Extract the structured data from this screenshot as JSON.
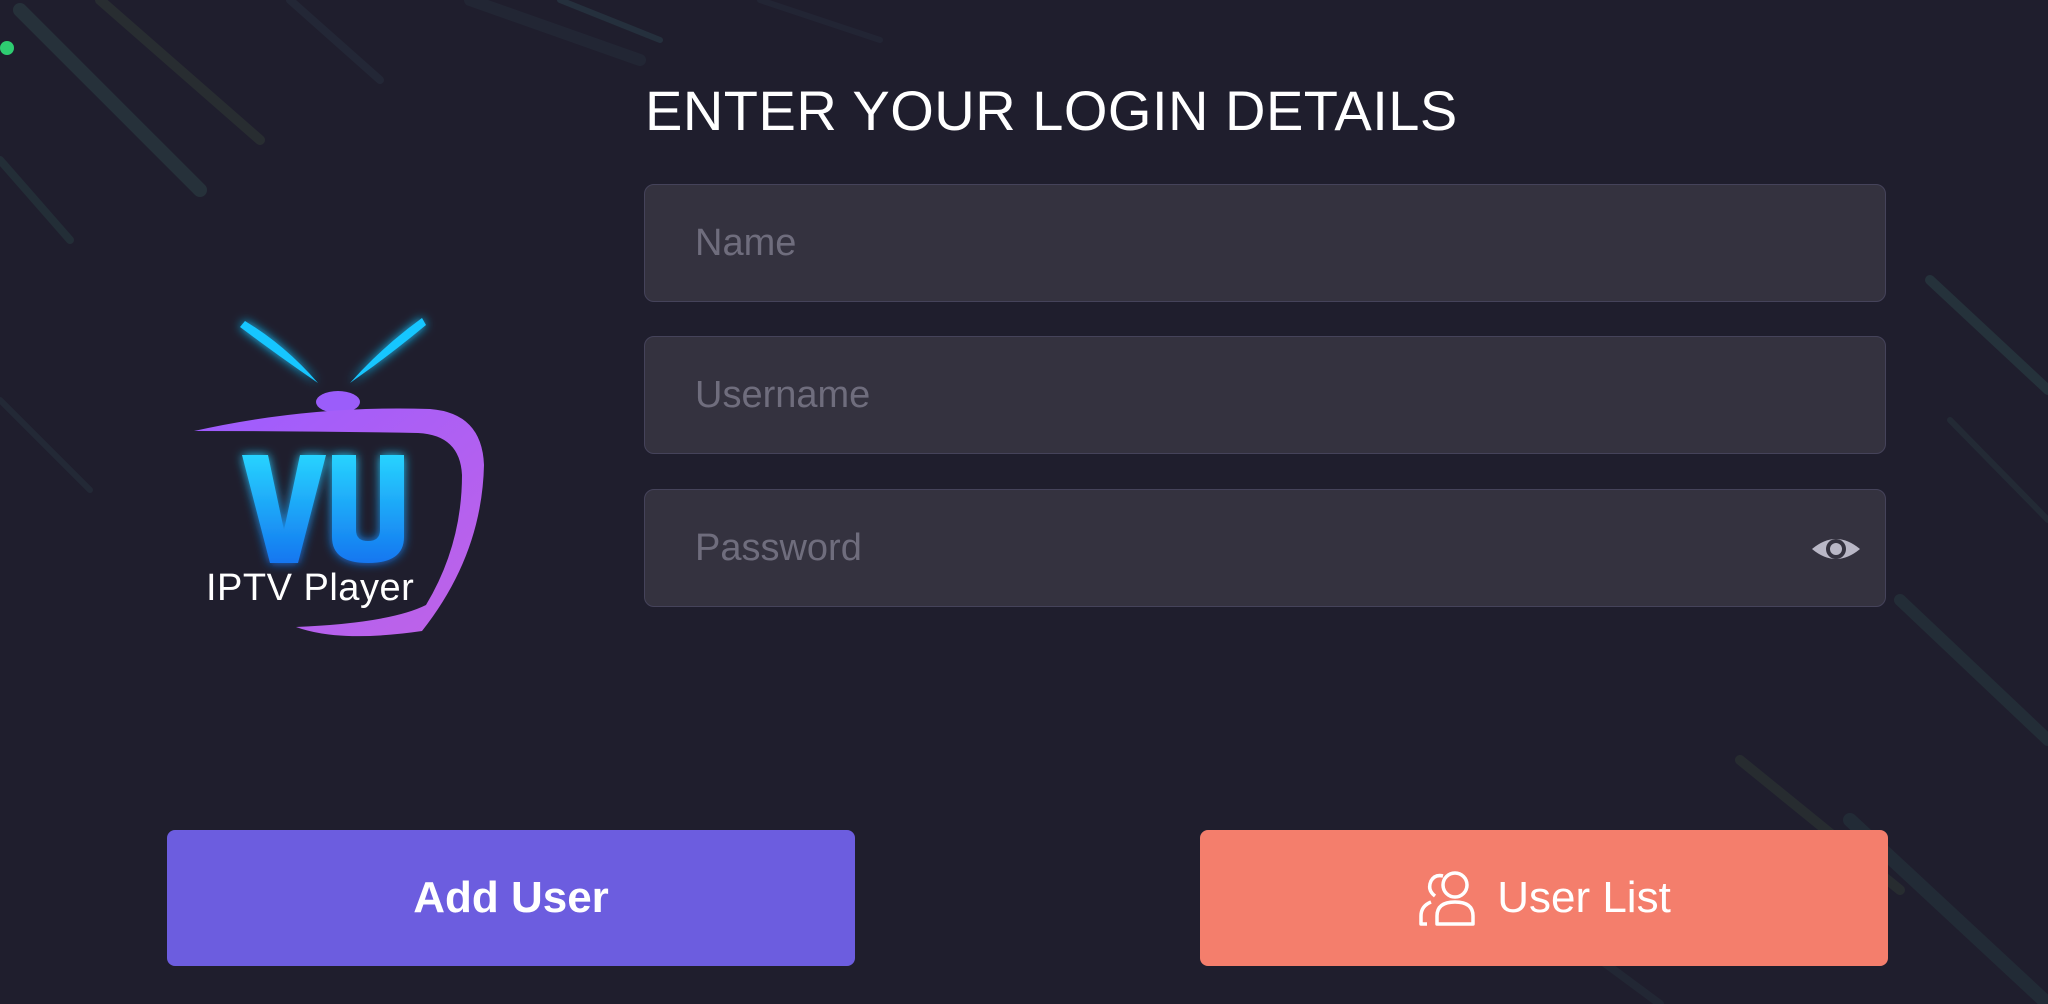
{
  "logo": {
    "wordmark": "VU",
    "subtitle": "IPTV Player"
  },
  "login": {
    "title": "ENTER YOUR LOGIN DETAILS",
    "name_placeholder": "Name",
    "username_placeholder": "Username",
    "password_placeholder": "Password",
    "password_toggle_icon": "eye-icon"
  },
  "actions": {
    "add_user_label": "Add User",
    "user_list_label": "User List",
    "user_list_icon": "users-icon"
  },
  "colors": {
    "background": "#1f1e2d",
    "field_background": "#34323f",
    "add_user": "#6c5ddf",
    "user_list": "#f47e6c",
    "status_dot": "#2ecc71"
  }
}
